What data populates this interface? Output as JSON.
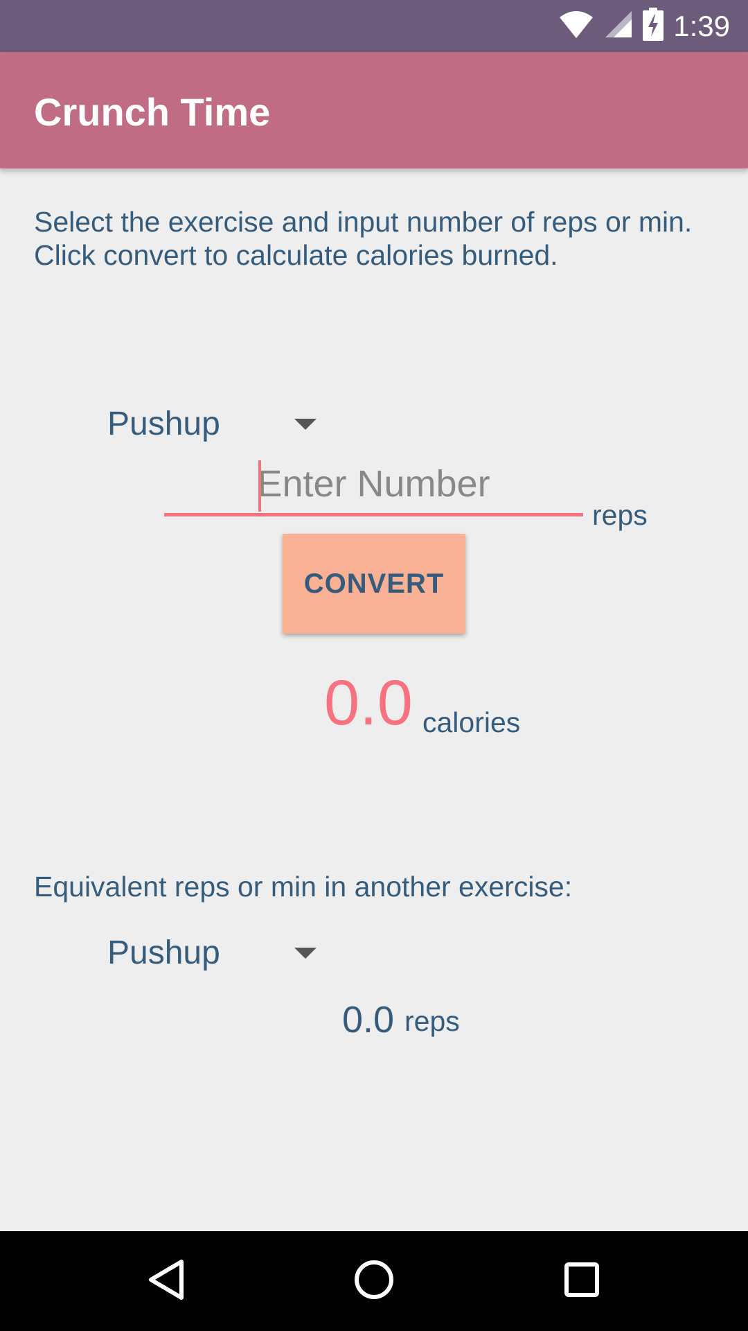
{
  "status_bar": {
    "time": "1:39",
    "icons": [
      "wifi-icon",
      "cell-signal-icon",
      "battery-charging-icon"
    ]
  },
  "app_bar": {
    "title": "Crunch Time"
  },
  "instructions": {
    "line1": "Select the exercise and input number of reps or min.",
    "line2": "Click convert to calculate calories burned."
  },
  "exercise_spinner": {
    "selected": "Pushup"
  },
  "number_input": {
    "value": "",
    "placeholder": "Enter Number"
  },
  "input_unit": "reps",
  "convert_button": {
    "label": "CONVERT"
  },
  "calories": {
    "value": "0.0",
    "unit": "calories"
  },
  "equivalent": {
    "label": "Equivalent reps or min in another exercise:",
    "spinner_selected": "Pushup",
    "value": "0.0",
    "unit": "reps"
  },
  "colors": {
    "status_bar": "#6C5B7B",
    "app_bar": "#C06C84",
    "accent": "#F67280",
    "button": "#F8B195",
    "text": "#355C7D",
    "background": "#EEEEEE"
  },
  "nav_bar": {
    "icons": [
      "back-icon",
      "home-icon",
      "recents-icon"
    ]
  }
}
